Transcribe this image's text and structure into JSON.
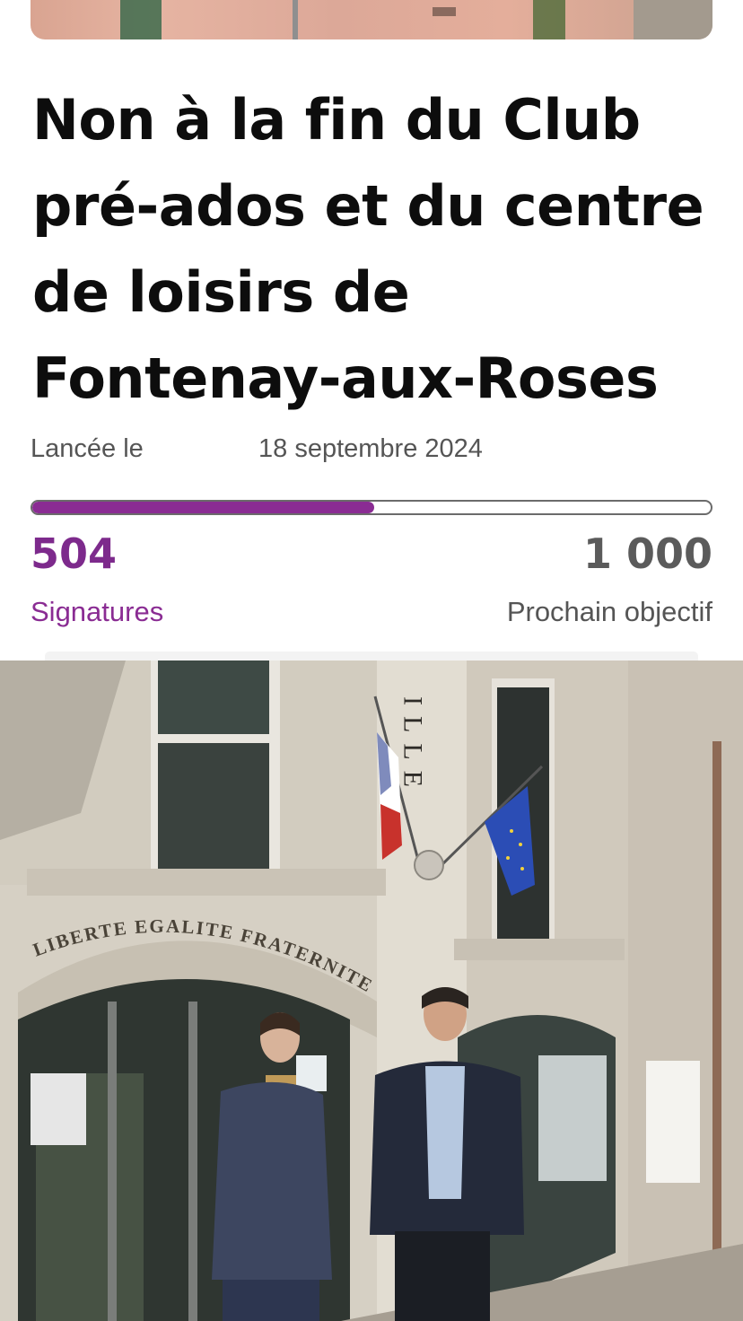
{
  "petition": {
    "title": "Non à la fin du Club pré-ados et du centre de loisirs de Fontenay-aux-Roses",
    "launch_label": "Lancée le",
    "launch_date": "18 septembre 2024",
    "signatures_count": "504",
    "signatures_label": "Signatures",
    "goal_count": "1 000",
    "goal_label": "Prochain objectif",
    "progress_fraction": 0.504
  },
  "photo": {
    "facade_text": "LIBERTE EGALITE FRATERNITE",
    "facade_vertical_text": "ILLE"
  },
  "colors": {
    "accent": "#8a2c93",
    "title": "#0d0d0d",
    "muted": "#555555"
  }
}
